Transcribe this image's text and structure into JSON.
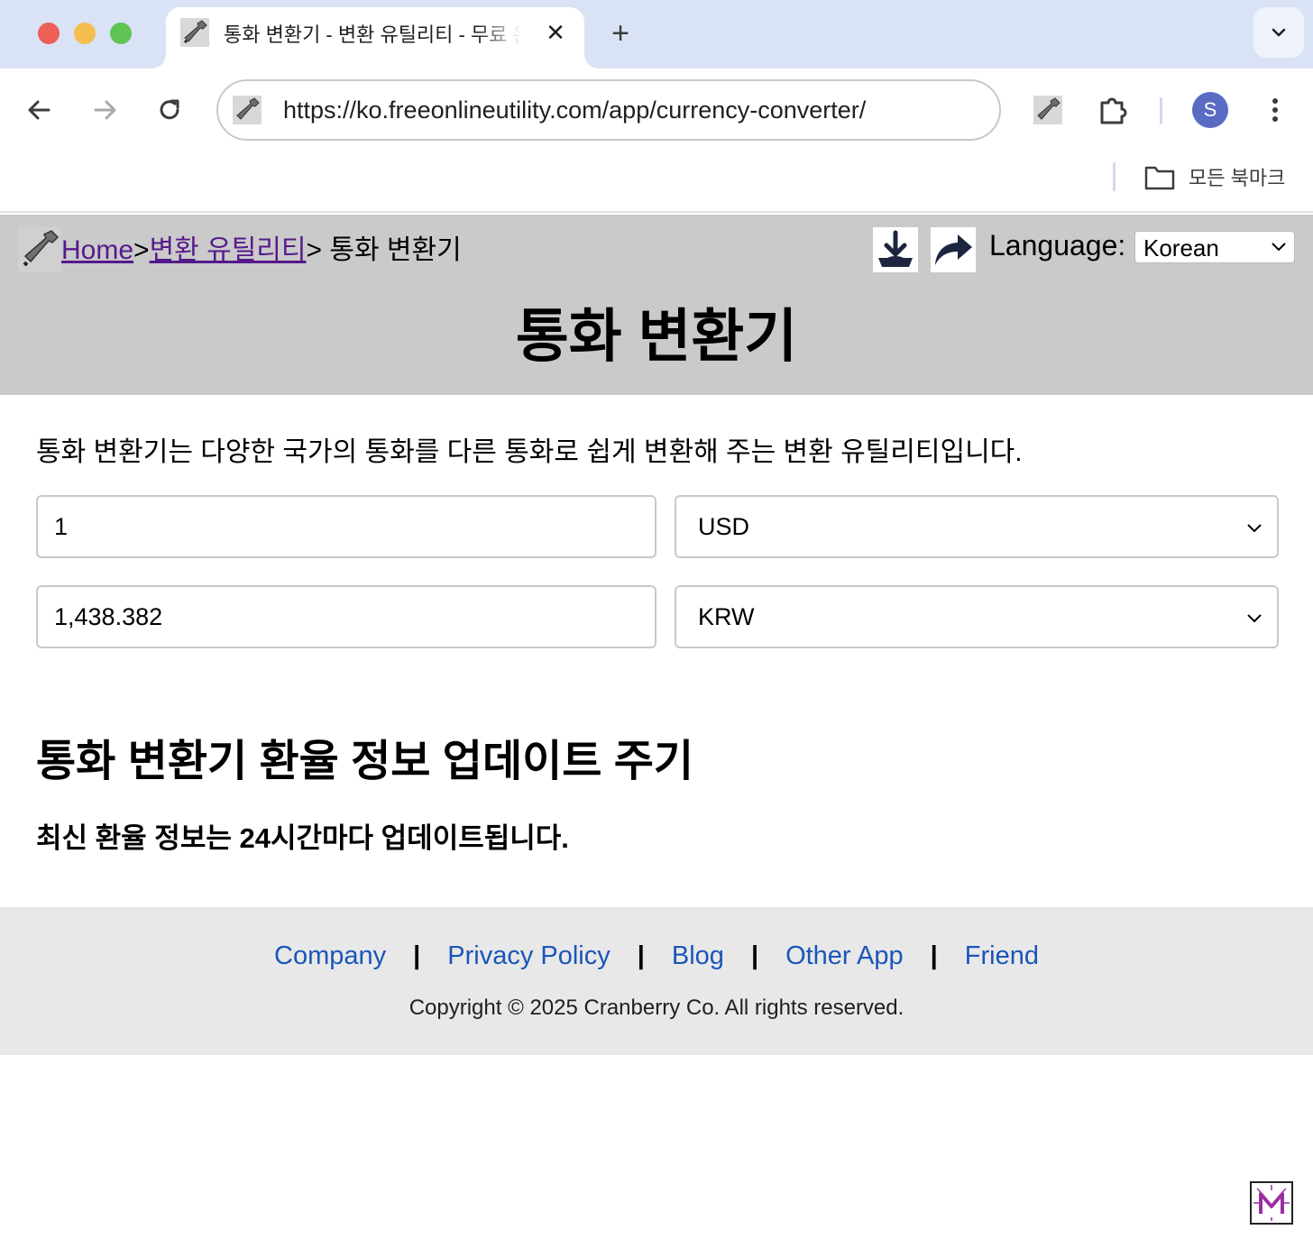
{
  "browser": {
    "tab_title": "통화 변환기 - 변환 유틸리티 - 무료 온라인 유틸리티",
    "tab_close": "✕",
    "new_tab": "+",
    "url": "https://ko.freeonlineutility.com/app/currency-converter/",
    "avatar_letter": "S",
    "bookmarks_label": "모든 북마크"
  },
  "header": {
    "breadcrumb": {
      "home": "Home",
      "sep1": ">",
      "category": "변환 유틸리티",
      "sep2": ">",
      "current": " 통화 변환기"
    },
    "language_label": "Language:",
    "language_selected": "Korean",
    "title": "통화 변환기"
  },
  "converter": {
    "description": "통화 변환기는 다양한 국가의 통화를 다른 통화로 쉽게 변환해 주는 변환 유틸리티입니다.",
    "amount": "1",
    "from_currency": "USD",
    "result": "1,438.382",
    "to_currency": "KRW"
  },
  "info": {
    "heading": "통화 변환기 환율 정보 업데이트 주기",
    "text": "최신 환율 정보는 24시간마다 업데이트됩니다."
  },
  "footer": {
    "links": [
      "Company",
      "Privacy Policy",
      "Blog",
      "Other App",
      "Friend"
    ],
    "separator": "|",
    "copyright": "Copyright © 2025 Cranberry Co. All rights reserved."
  },
  "icons": {
    "traffic_close": "#ee5f57",
    "traffic_minimize": "#f5bd4f",
    "traffic_maximize": "#5fc454",
    "favicon": "wrench-icon",
    "download": "download-icon",
    "share": "share-icon",
    "corner_logo": "m-logo-icon"
  },
  "colors": {
    "header_bg": "#cacaca",
    "footer_bg": "#e8e8e8",
    "link": "#1a56b8",
    "visited_link": "#551a8b"
  }
}
